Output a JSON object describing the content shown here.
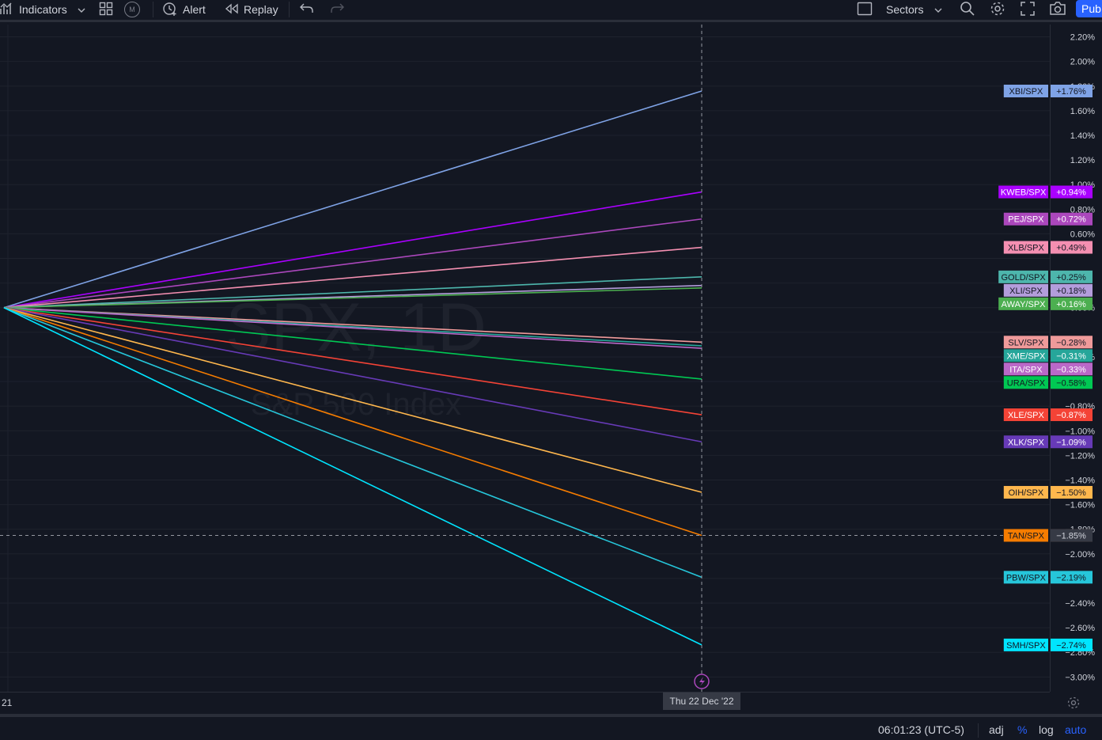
{
  "toolbar": {
    "indicators_label": "Indicators",
    "m_badge": "M",
    "alert_label": "Alert",
    "replay_label": "Replay",
    "sectors_label": "Sectors",
    "publish_label": "Pub"
  },
  "watermark": {
    "symbol": "SPX, 1D",
    "description": "S&P 500 Index"
  },
  "time_axis": {
    "left_label": "21",
    "crosshair_label": "Thu 22 Dec '22"
  },
  "bottom_bar": {
    "clock": "06:01:23 (UTC-5)",
    "adj": "adj",
    "percent": "%",
    "log": "log",
    "auto": "auto"
  },
  "colors": {
    "background": "#131722",
    "grid": "#1e222d",
    "axis_text": "#d1d4dc",
    "accent": "#2962ff"
  },
  "chart_data": {
    "type": "line",
    "x": [
      "start",
      "Thu 22 Dec '22"
    ],
    "ylim": [
      -3.12,
      2.3
    ],
    "y_ticks": [
      "2.20%",
      "2.00%",
      "1.80%",
      "1.60%",
      "1.40%",
      "1.20%",
      "1.00%",
      "0.80%",
      "0.60%",
      "0.00%",
      "−0.40%",
      "−0.80%",
      "−1.00%",
      "−1.20%",
      "−1.40%",
      "−1.60%",
      "−1.80%",
      "−2.00%",
      "−2.40%",
      "−2.60%",
      "−2.80%",
      "−3.00%"
    ],
    "y_tick_values": [
      2.2,
      2.0,
      1.8,
      1.6,
      1.4,
      1.2,
      1.0,
      0.8,
      0.6,
      0.0,
      -0.4,
      -0.8,
      -1.0,
      -1.2,
      -1.4,
      -1.6,
      -1.8,
      -2.0,
      -2.4,
      -2.6,
      -2.8,
      -3.0
    ],
    "grid_values": [
      2.2,
      2.0,
      1.8,
      1.6,
      1.4,
      1.2,
      1.0,
      0.8,
      0.6,
      0.4,
      0.2,
      0.0,
      -0.2,
      -0.4,
      -0.6,
      -0.8,
      -1.0,
      -1.2,
      -1.4,
      -1.6,
      -1.8,
      -2.0,
      -2.2,
      -2.4,
      -2.6,
      -2.8,
      -3.0
    ],
    "crosshair_value": -1.85,
    "crosshair_label": "−1.85%",
    "series": [
      {
        "name": "XBI/SPX",
        "label": "+1.76%",
        "value": 1.76,
        "color": "#7fa3e6",
        "text_color": "#131722"
      },
      {
        "name": "KWEB/SPX",
        "label": "+0.94%",
        "value": 0.94,
        "color": "#aa00ff",
        "text_color": "#ffffff"
      },
      {
        "name": "PEJ/SPX",
        "label": "+0.72%",
        "value": 0.72,
        "color": "#ab47bc",
        "text_color": "#ffffff"
      },
      {
        "name": "XLB/SPX",
        "label": "+0.49%",
        "value": 0.49,
        "color": "#f48fb1",
        "text_color": "#131722"
      },
      {
        "name": "GOLD/SPX",
        "label": "+0.25%",
        "value": 0.25,
        "color": "#4db6ac",
        "text_color": "#131722"
      },
      {
        "name": "XLI/SPX",
        "label": "+0.18%",
        "value": 0.18,
        "color": "#b39ddb",
        "text_color": "#131722"
      },
      {
        "name": "AWAY/SPX",
        "label": "+0.16%",
        "value": 0.16,
        "color": "#4caf50",
        "text_color": "#ffffff"
      },
      {
        "name": "SLV/SPX",
        "label": "−0.28%",
        "value": -0.28,
        "color": "#ef9a9a",
        "text_color": "#131722"
      },
      {
        "name": "XME/SPX",
        "label": "−0.31%",
        "value": -0.31,
        "color": "#26a69a",
        "text_color": "#ffffff"
      },
      {
        "name": "ITA/SPX",
        "label": "−0.33%",
        "value": -0.33,
        "color": "#ba68c8",
        "text_color": "#ffffff"
      },
      {
        "name": "URA/SPX",
        "label": "−0.58%",
        "value": -0.58,
        "color": "#00c853",
        "text_color": "#131722"
      },
      {
        "name": "XLE/SPX",
        "label": "−0.87%",
        "value": -0.87,
        "color": "#f44336",
        "text_color": "#ffffff"
      },
      {
        "name": "XLK/SPX",
        "label": "−1.09%",
        "value": -1.09,
        "color": "#673ab7",
        "text_color": "#ffffff"
      },
      {
        "name": "OIH/SPX",
        "label": "−1.50%",
        "value": -1.5,
        "color": "#ffb74d",
        "text_color": "#131722"
      },
      {
        "name": "TAN/SPX",
        "label": "−1.85%",
        "value": -1.85,
        "color": "#f57c00",
        "text_color": "#131722"
      },
      {
        "name": "PBW/SPX",
        "label": "−2.19%",
        "value": -2.19,
        "color": "#26c6da",
        "text_color": "#131722"
      },
      {
        "name": "SMH/SPX",
        "label": "−2.74%",
        "value": -2.74,
        "color": "#00e5ff",
        "text_color": "#131722"
      }
    ]
  }
}
